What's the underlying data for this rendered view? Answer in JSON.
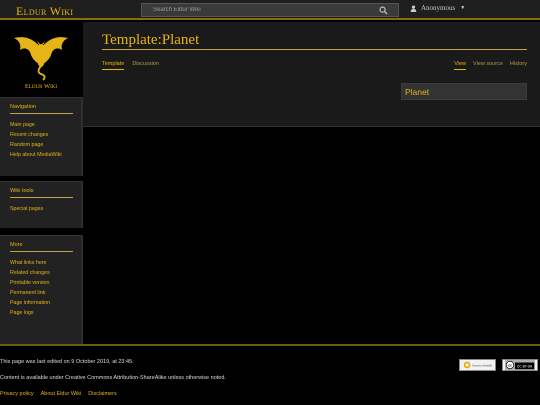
{
  "header": {
    "site_title": "Eldur Wiki",
    "search": {
      "placeholder": "Search Eldur Wiki"
    },
    "user_menu_label": "Anonymous"
  },
  "sidebar": {
    "logo_text": "Eldur Wiki",
    "portlets": [
      {
        "title": "Navigation",
        "items": [
          "Main page",
          "Recent changes",
          "Random page",
          "Help about MediaWiki"
        ]
      },
      {
        "title": "Wiki tools",
        "items": [
          "Special pages"
        ]
      },
      {
        "title": "More",
        "items": [
          "What links here",
          "Related changes",
          "Printable version",
          "Permanent link",
          "Page information",
          "Page logs"
        ]
      }
    ]
  },
  "main": {
    "title": "Template:Planet",
    "tabs_left": [
      "Template",
      "Discussion"
    ],
    "tabs_right": [
      "View",
      "View source",
      "History"
    ],
    "infobox_title": "Planet"
  },
  "footer": {
    "last_edited": "This page was last edited on 9 October 2019, at 23:45.",
    "license": "Content is available under Creative Commons Attribution-ShareAlike unless otherwise noted.",
    "links": [
      "Privacy policy",
      "About Eldur Wiki",
      "Disclaimers"
    ],
    "badges": [
      "Powered by MediaWiki",
      "CC BY-SA"
    ]
  },
  "colors": {
    "accent": "#e7b418",
    "background": "#000000",
    "panel": "#222222",
    "content_bg": "#1a1a1a"
  }
}
